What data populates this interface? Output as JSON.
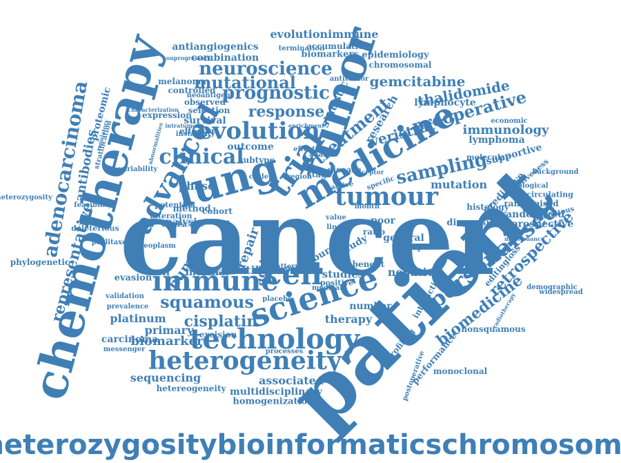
{
  "color": "#3f7fb6",
  "words": [
    "cancer",
    "patient",
    "chemotherapy",
    "tumor",
    "lung",
    "trial",
    "medicine",
    "science",
    "immune",
    "technology",
    "heterogeneity",
    "cell",
    "clinical",
    "evolution",
    "advanced",
    "tumour",
    "neuroscience",
    "adenocarcinoma",
    "personalised",
    "response",
    "prognostic",
    "mutational",
    "treatment",
    "squamous",
    "cisplatin",
    "sampling",
    "retrospective",
    "biomedicine",
    "preoperative",
    "gemcitabine",
    "immunology",
    "thalidomide",
    "mutation",
    "phase",
    "analysis",
    "human",
    "repair",
    "activity",
    "futility",
    "studies",
    "negative",
    "therapy",
    "platinum",
    "carcinoma",
    "biomarker",
    "primary",
    "sequencing",
    "associated",
    "multidisciplinary",
    "homogenization",
    "hetereogeneity",
    "processes",
    "representative",
    "antibodies",
    "proteomic",
    "evolutionimmune",
    "accumulation",
    "termination",
    "biomarkers",
    "epidemiology",
    "chromosomal",
    "antiangiogenics",
    "combination",
    "melanoma",
    "controlled",
    "neoantigens",
    "observed",
    "expression",
    "selection",
    "survival",
    "effector",
    "instability",
    "lymphocyte",
    "veristrat",
    "lymphoma",
    "economic",
    "supportive",
    "molecular",
    "predictive",
    "randomized",
    "randomised",
    "prospective",
    "histology",
    "diagnosis",
    "general",
    "ratio",
    "poor",
    "study",
    "burden",
    "cell",
    "internal",
    "evasion",
    "method",
    "outcome",
    "subtype",
    "cohort",
    "design",
    "alteration",
    "potential",
    "landscape",
    "phylogenetic",
    "heterozygosity",
    "feasibility",
    "deleterious",
    "paclitaxel",
    "validation",
    "prevalence",
    "messenger",
    "neoplasm",
    "placebo",
    "excision",
    "number",
    "benefit",
    "escape",
    "cycle",
    "stage",
    "region",
    "disease",
    "analyse",
    "effect",
    "stratification",
    "biological",
    "background",
    "circulating",
    "ubiquitous",
    "demographic",
    "widespread",
    "nonsquamous",
    "monoclonal",
    "performance",
    "profiling",
    "postoperative",
    "editingloss",
    "effectiveness",
    "maintenance",
    "radiotherapy",
    "genomic",
    "interaction",
    "positive",
    "medical",
    "pattern",
    "more",
    "nonprogressors",
    "antitumor",
    "statistic",
    "research",
    "intratumor",
    "regulatory",
    "variability",
    "abnormalities",
    "characterization",
    "enrichment",
    "specific",
    "active",
    "month",
    "receptor",
    "value",
    "line",
    "heterozygositybioinformaticschromosomal"
  ]
}
